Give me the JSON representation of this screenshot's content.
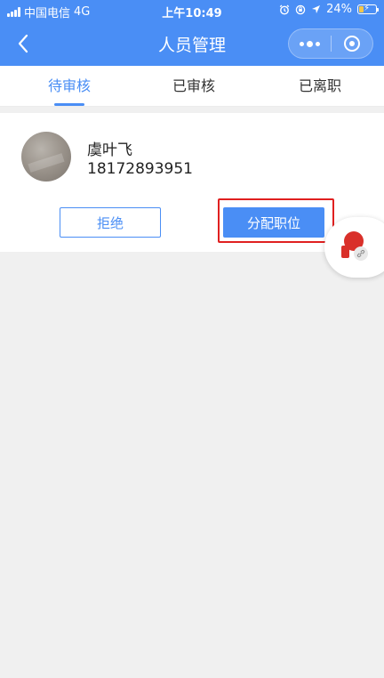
{
  "status_bar": {
    "carrier": "中国电信",
    "network": "4G",
    "time": "上午10:49",
    "battery_percent": "24%",
    "battery_level": 0.24,
    "battery_color": "#f3c64a"
  },
  "nav": {
    "title": "人员管理",
    "back_icon": "chevron-left-icon",
    "menu_icon": "more-dots-icon",
    "close_icon": "target-circle-icon"
  },
  "tabs": [
    {
      "label": "待审核",
      "active": true
    },
    {
      "label": "已审核",
      "active": false
    },
    {
      "label": "已离职",
      "active": false
    }
  ],
  "applicant": {
    "name": "虞叶飞",
    "phone": "18172893951",
    "reject_label": "拒绝",
    "assign_label": "分配职位"
  },
  "colors": {
    "primary": "#4a8ef5",
    "highlight": "#e02020",
    "background": "#f0f0f0"
  }
}
